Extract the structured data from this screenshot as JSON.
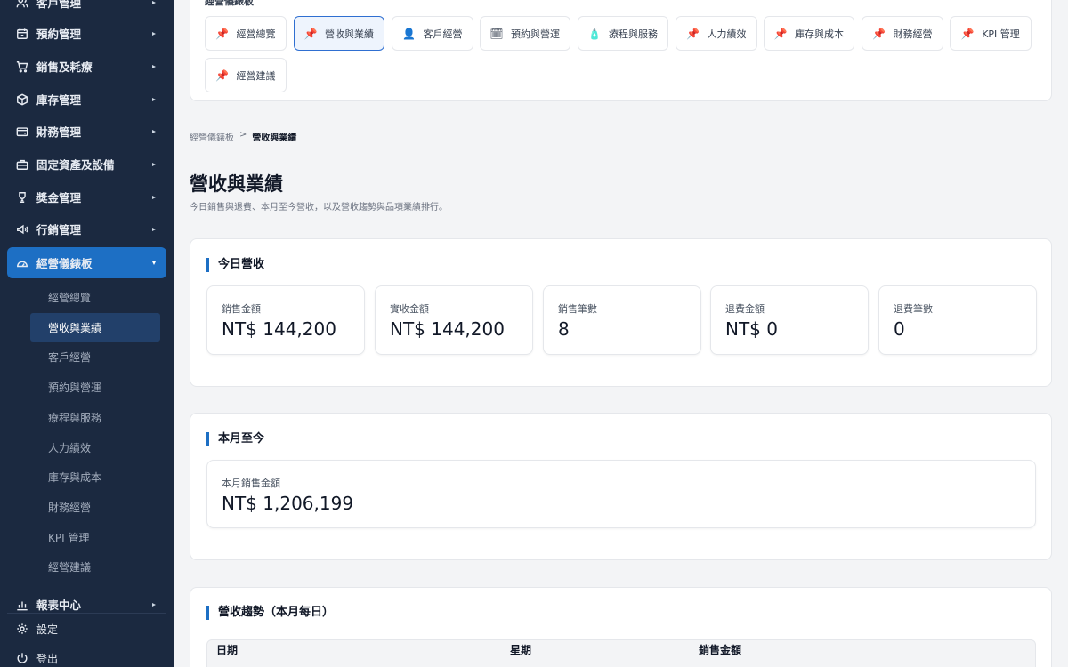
{
  "sidebar": {
    "items": [
      {
        "label": "客戶管理",
        "icon": "users-icon"
      },
      {
        "label": "預約管理",
        "icon": "calendar-icon"
      },
      {
        "label": "銷售及耗療",
        "icon": "cart-icon"
      },
      {
        "label": "庫存管理",
        "icon": "box-icon"
      },
      {
        "label": "財務管理",
        "icon": "wallet-icon"
      },
      {
        "label": "固定資產及設備",
        "icon": "briefcase-icon"
      },
      {
        "label": "獎金管理",
        "icon": "trophy-icon"
      },
      {
        "label": "行銷管理",
        "icon": "megaphone-icon"
      },
      {
        "label": "經營儀錶板",
        "icon": "gauge-icon"
      }
    ],
    "subitems": [
      "經營總覽",
      "營收與業績",
      "客戶經營",
      "預約與營運",
      "療程與服務",
      "人力績效",
      "庫存與成本",
      "財務經營",
      "KPI 管理",
      "經營建議"
    ],
    "report": {
      "label": "報表中心",
      "icon": "bar-chart-icon"
    },
    "settings": "設定",
    "logout": "登出"
  },
  "quick": {
    "title": "經營儀錶板",
    "buttons": [
      {
        "label": "經營總覽",
        "icon": "pushpin-icon",
        "glyph": "📌"
      },
      {
        "label": "營收與業績",
        "icon": "pushpin-icon",
        "glyph": "📌"
      },
      {
        "label": "客戶經營",
        "icon": "person-icon",
        "glyph": "👤"
      },
      {
        "label": "預約與營運",
        "icon": "calendar-icon",
        "glyph": "🗓"
      },
      {
        "label": "療程與服務",
        "icon": "lotion-icon",
        "glyph": "🧴"
      },
      {
        "label": "人力績效",
        "icon": "pushpin-icon",
        "glyph": "📌"
      },
      {
        "label": "庫存與成本",
        "icon": "pushpin-icon",
        "glyph": "📌"
      },
      {
        "label": "財務經營",
        "icon": "pushpin-icon",
        "glyph": "📌"
      },
      {
        "label": "KPI 管理",
        "icon": "pushpin-icon",
        "glyph": "📌"
      },
      {
        "label": "經營建議",
        "icon": "pushpin-icon",
        "glyph": "📌"
      }
    ]
  },
  "breadcrumb": {
    "root": "經營儀錶板",
    "sep": ">",
    "current": "營收與業績"
  },
  "page": {
    "title": "營收與業績",
    "desc": "今日銷售與退費、本月至今營收，以及營收趨勢與品項業績排行。"
  },
  "today": {
    "title": "今日營收",
    "stats": [
      {
        "label": "銷售金額",
        "value": "NT$ 144,200"
      },
      {
        "label": "實收金額",
        "value": "NT$ 144,200"
      },
      {
        "label": "銷售筆數",
        "value": "8"
      },
      {
        "label": "退費金額",
        "value": "NT$ 0"
      },
      {
        "label": "退費筆數",
        "value": "0"
      }
    ]
  },
  "month": {
    "title": "本月至今",
    "stat": {
      "label": "本月銷售金額",
      "value": "NT$ 1,206,199"
    }
  },
  "trend": {
    "title": "營收趨勢（本月每日）",
    "columns": [
      "日期",
      "星期",
      "銷售金額"
    ]
  },
  "colors": {
    "sidebar_bg": "#1b2940",
    "accent": "#1d6fc4",
    "selected_sub": "#22406a"
  }
}
